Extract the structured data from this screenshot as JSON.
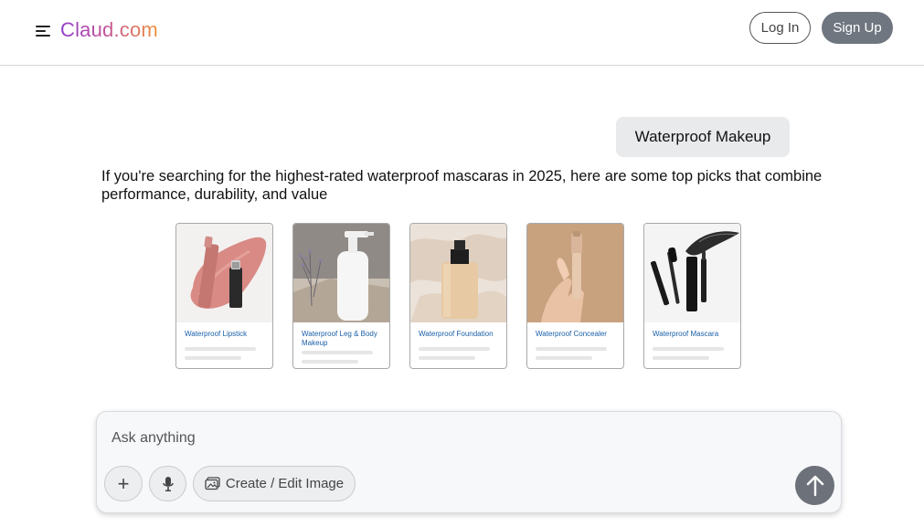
{
  "header": {
    "logo": "Claud.com",
    "login_label": "Log In",
    "signup_label": "Sign Up",
    "icons": {
      "menu": "menu-icon"
    }
  },
  "chat": {
    "user_message": "Waterproof Makeup",
    "answer": "If you're searching for the highest-rated waterproof mascaras in 2025, here are some top picks that combine performance, durability, and value"
  },
  "products": [
    {
      "label": "Waterproof Lipstick"
    },
    {
      "label": "Waterproof Leg & Body Makeup"
    },
    {
      "label": "Waterproof Foundation"
    },
    {
      "label": "Waterproof Concealer"
    },
    {
      "label": "Waterproof Mascara"
    }
  ],
  "composer": {
    "placeholder": "Ask anything",
    "plus_label": "+",
    "image_label": "Create / Edit Image",
    "icons": {
      "mic": "microphone-icon",
      "image": "image-icon",
      "send": "arrow-up-icon"
    }
  },
  "colors": {
    "brand_gradient": [
      "#8f3fc9",
      "#c2519b",
      "#f0913a"
    ],
    "signup_bg": "#6f7680",
    "link_blue": "#1b5fa8",
    "send_bg": "#6d727a"
  }
}
